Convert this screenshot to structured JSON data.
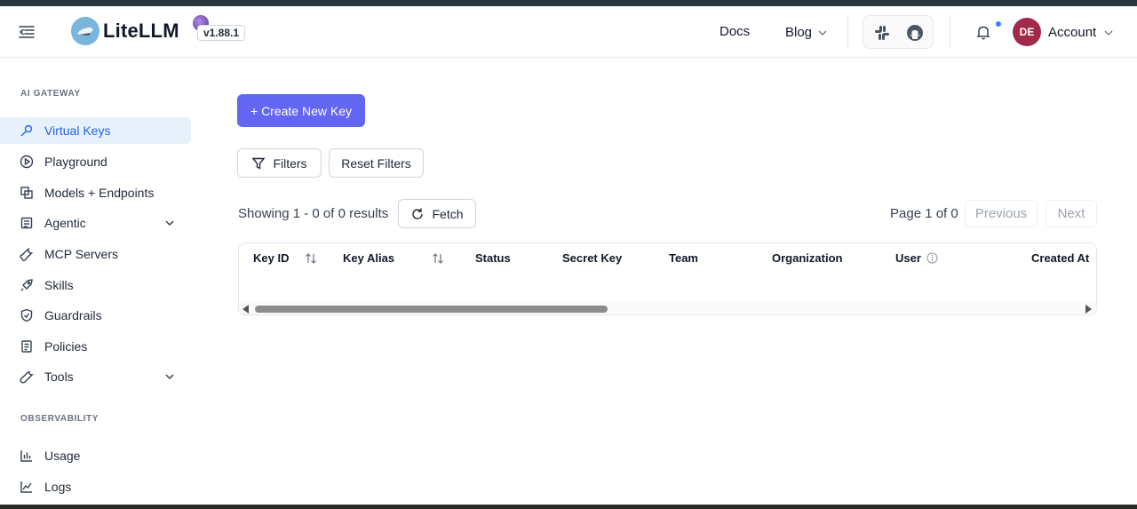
{
  "header": {
    "brand": "LiteLLM",
    "version": "v1.88.1",
    "nav_docs": "Docs",
    "nav_blog": "Blog",
    "avatar_initials": "DE",
    "account_label": "Account",
    "notification_color": "#3b82f6",
    "avatar_color": "#9f2a4a"
  },
  "sidebar": {
    "section_gateway": "AI GATEWAY",
    "section_observability": "OBSERVABILITY",
    "items": [
      {
        "label": "Virtual Keys",
        "icon": "key-icon",
        "active": true
      },
      {
        "label": "Playground",
        "icon": "play-circle-icon"
      },
      {
        "label": "Models + Endpoints",
        "icon": "copy-icon"
      },
      {
        "label": "Agentic",
        "icon": "robot-icon",
        "expandable": true
      },
      {
        "label": "MCP Servers",
        "icon": "wrench-icon"
      },
      {
        "label": "Skills",
        "icon": "rocket-icon"
      },
      {
        "label": "Guardrails",
        "icon": "shield-icon"
      },
      {
        "label": "Policies",
        "icon": "document-icon"
      },
      {
        "label": "Tools",
        "icon": "tool-icon",
        "expandable": true
      },
      {
        "label": "Usage",
        "icon": "bar-chart-icon"
      },
      {
        "label": "Logs",
        "icon": "line-chart-icon"
      }
    ]
  },
  "main": {
    "create_key": "+ Create New Key",
    "filters": "Filters",
    "reset_filters": "Reset Filters",
    "showing": "Showing 1 - 0 of 0 results",
    "fetch": "Fetch",
    "page_info": "Page 1 of 0",
    "previous": "Previous",
    "next": "Next",
    "accent_color": "#6366f1",
    "columns": [
      "Key ID",
      "Key Alias",
      "Status",
      "Secret Key",
      "Team",
      "Organization",
      "User",
      "Created At"
    ]
  }
}
